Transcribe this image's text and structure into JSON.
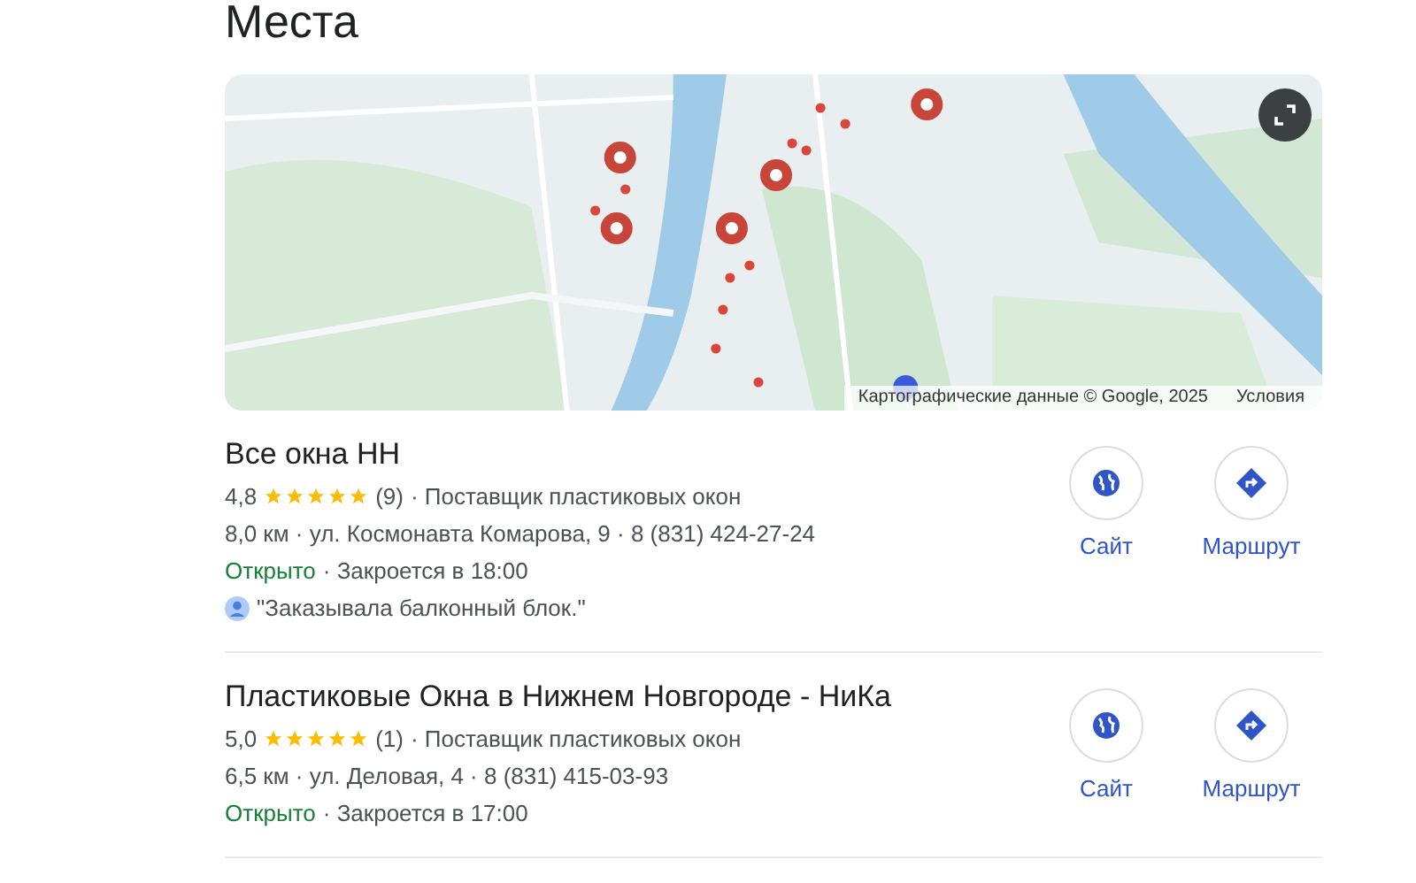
{
  "heading": "Места",
  "map": {
    "attribution": "Картографические данные © Google, 2025",
    "terms": "Условия"
  },
  "places": [
    {
      "name": "Все окна НН",
      "rating": "4,8",
      "stars": 5,
      "reviews_count": "(9)",
      "category": "· Поставщик пластиковых окон",
      "contact": "8,0 км · ул. Космонавта Комарова, 9 · 8 (831) 424-27-24",
      "status": "Открыто",
      "open": true,
      "hours": "· Закроется в 18:00",
      "review": "\"Заказывала балконный блок.\"",
      "actions": [
        {
          "kind": "website",
          "label": "Сайт"
        },
        {
          "kind": "directions",
          "label": "Маршрут"
        }
      ]
    },
    {
      "name": "Пластиковые Окна в Нижнем Новгороде - НиКа",
      "rating": "5,0",
      "stars": 5,
      "reviews_count": "(1)",
      "category": "· Поставщик пластиковых окон",
      "contact": "6,5 км · ул. Деловая, 4 · 8 (831) 415-03-93",
      "status": "Открыто",
      "open": true,
      "hours": "· Закроется в 17:00",
      "actions": [
        {
          "kind": "website",
          "label": "Сайт"
        },
        {
          "kind": "directions",
          "label": "Маршрут"
        }
      ]
    }
  ]
}
